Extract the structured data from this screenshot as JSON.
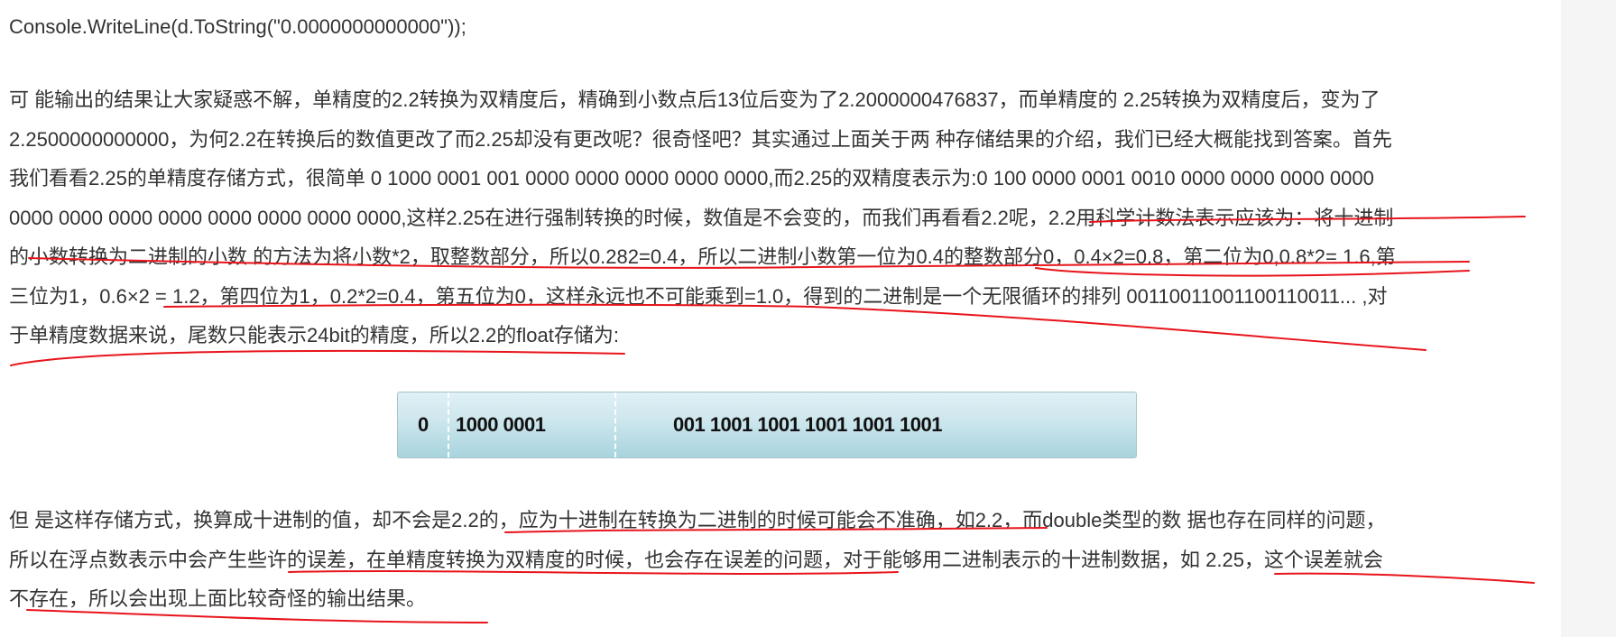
{
  "code_line": "Console.WriteLine(d.ToString(\"0.0000000000000\"));",
  "paragraph1": {
    "lines": [
      "可 能输出的结果让大家疑惑不解，单精度的2.2转换为双精度后，精确到小数点后13位后变为了2.2000000476837，而单精度的 2.25转换为双精度后，变为了",
      "2.2500000000000，为何2.2在转换后的数值更改了而2.25却没有更改呢？很奇怪吧？其实通过上面关于两 种存储结果的介绍，我们已经大概能找到答案。首先",
      "我们看看2.25的单精度存储方式，很简单 0 1000 0001 001 0000 0000 0000 0000 0000,而2.25的双精度表示为:0 100 0000 0001 0010 0000 0000 0000 0000",
      "0000 0000 0000 0000 0000 0000 0000 0000,这样2.25在进行强制转换的时候，数值是不会变的，而我们再看看2.2呢，2.2用科学计数法表示应该为：将十进制",
      "的小数转换为二进制的小数 的方法为将小数*2，取整数部分，所以0.282=0.4，所以二进制小数第一位为0.4的整数部分0，0.4×2=0.8，第二位为0,0.8*2= 1.6,第",
      "三位为1，0.6×2 = 1.2，第四位为1，0.2*2=0.4，第五位为0，这样永远也不可能乘到=1.0，得到的二进制是一个无限循环的排列 00110011001100110011... ,对",
      "于单精度数据来说，尾数只能表示24bit的精度，所以2.2的float存储为:"
    ]
  },
  "figure": {
    "sign": "0",
    "exponent": "1000 0001",
    "mantissa": "001 1001 1001 1001 1001 1001"
  },
  "paragraph2": {
    "lines": [
      "但 是这样存储方式，换算成十进制的值，却不会是2.2的，应为十进制在转换为二进制的时候可能会不准确，如2.2，而double类型的数 据也存在同样的问题，",
      "所以在浮点数表示中会产生些许的误差，在单精度转换为双精度的时候，也会存在误差的问题，对于能够用二进制表示的十进制数据，如 2.25，这个误差就会",
      "不存在，所以会出现上面比较奇怪的输出结果。"
    ]
  },
  "annotation_color": "#e8141b"
}
